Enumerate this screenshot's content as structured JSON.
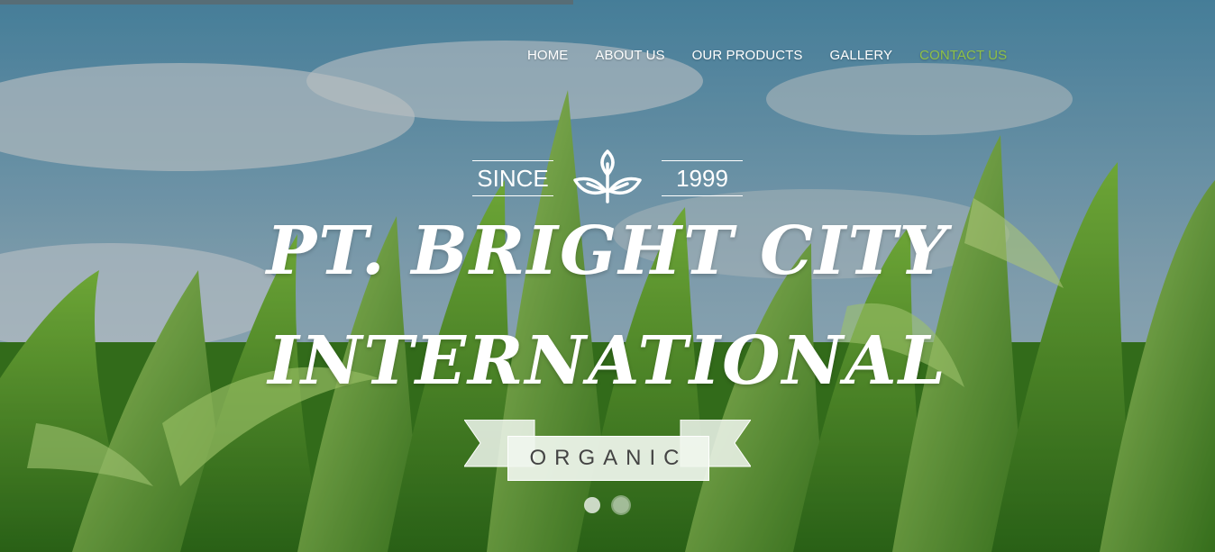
{
  "nav": {
    "items": [
      {
        "label": "HOME",
        "active": false
      },
      {
        "label": "ABOUT US",
        "active": false
      },
      {
        "label": "OUR PRODUCTS",
        "active": false
      },
      {
        "label": "GALLERY",
        "active": false
      },
      {
        "label": "CONTACT US",
        "active": true
      }
    ]
  },
  "hero": {
    "since_label": "SINCE",
    "year": "1999",
    "emblem_icon": "leaf-sprout-icon",
    "title_line1": "PT. BRIGHT CITY",
    "title_line2": "INTERNATIONAL",
    "ribbon_label": "ORGANIC",
    "slides": 2,
    "active_slide": 2
  },
  "colors": {
    "accent": "#8fc046",
    "sky": "#6f9bb3",
    "leaf": "#3f8a22"
  }
}
